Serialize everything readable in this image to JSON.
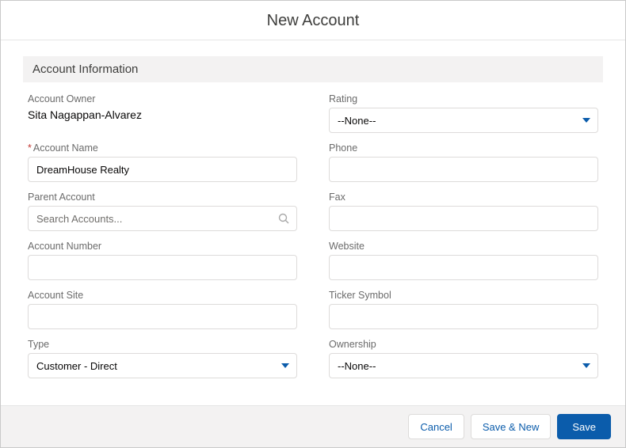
{
  "header": {
    "title": "New Account"
  },
  "section": {
    "title": "Account Information"
  },
  "fields": {
    "owner_label": "Account Owner",
    "owner_value": "Sita Nagappan-Alvarez",
    "rating_label": "Rating",
    "rating_value": "--None--",
    "account_name_label": "Account Name",
    "account_name_value": "DreamHouse Realty",
    "phone_label": "Phone",
    "phone_value": "",
    "parent_label": "Parent Account",
    "parent_placeholder": "Search Accounts...",
    "fax_label": "Fax",
    "fax_value": "",
    "account_number_label": "Account Number",
    "account_number_value": "",
    "website_label": "Website",
    "website_value": "",
    "account_site_label": "Account Site",
    "account_site_value": "",
    "ticker_label": "Ticker Symbol",
    "ticker_value": "",
    "type_label": "Type",
    "type_value": "Customer - Direct",
    "ownership_label": "Ownership",
    "ownership_value": "--None--"
  },
  "buttons": {
    "cancel": "Cancel",
    "save_new": "Save & New",
    "save": "Save"
  }
}
